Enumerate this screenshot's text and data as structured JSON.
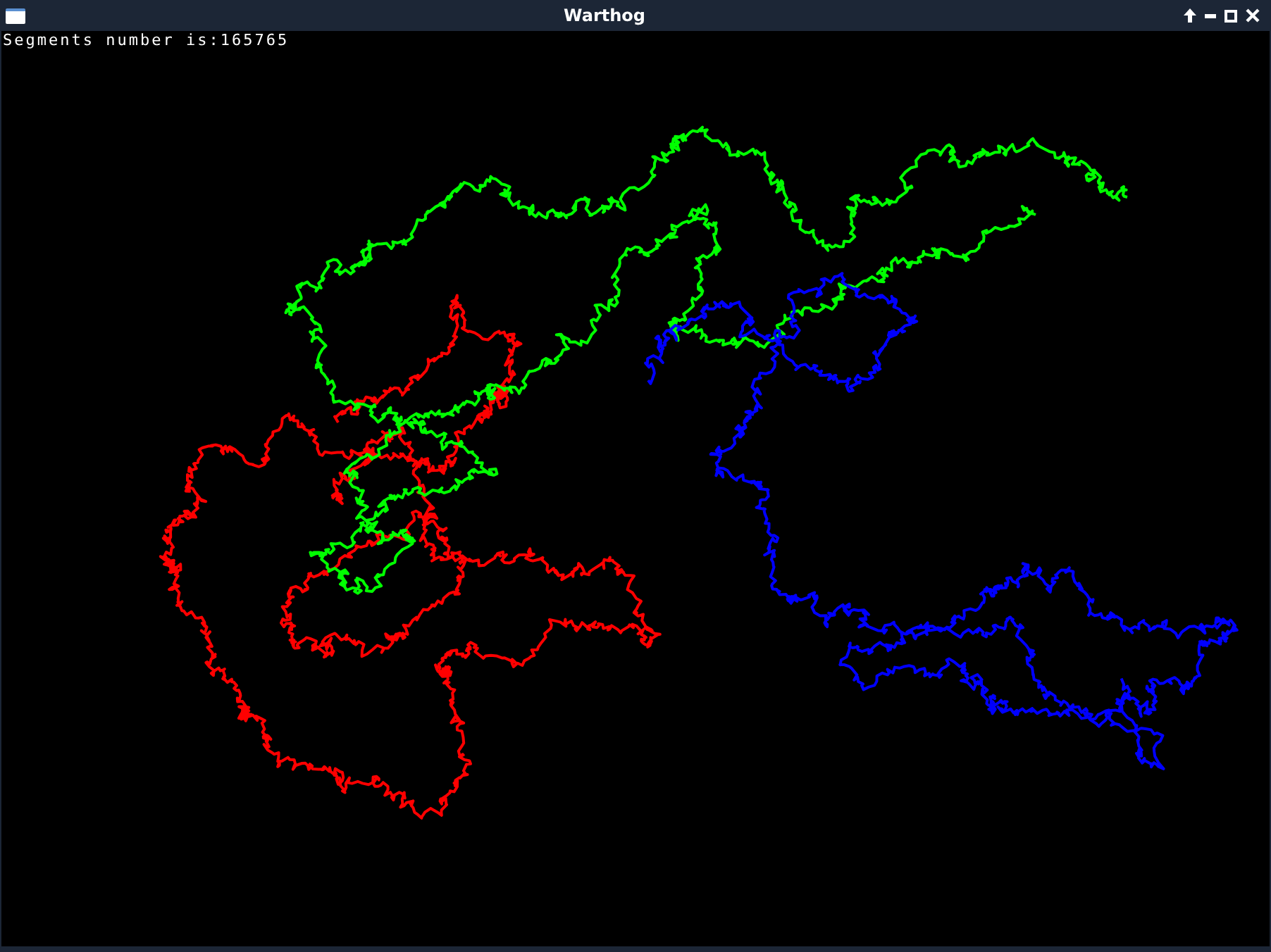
{
  "window": {
    "title": "Warthog"
  },
  "canvas": {
    "status_text": "Segments number is:165765",
    "walks": [
      {
        "color": "#ff0000"
      },
      {
        "color": "#00ff00"
      },
      {
        "color": "#0000ff"
      }
    ]
  }
}
